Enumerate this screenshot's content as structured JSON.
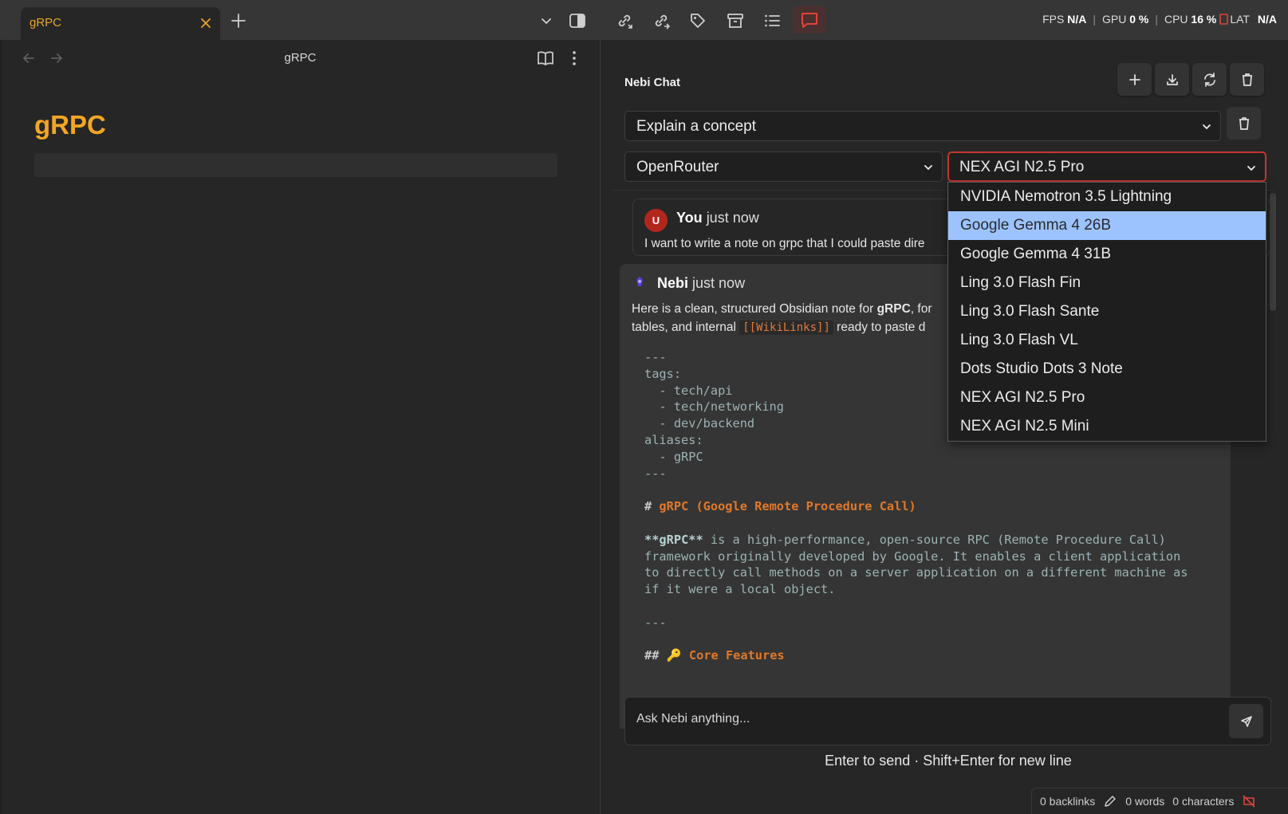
{
  "titlebar": {
    "tab_title": "gRPC",
    "status": {
      "fps_label": "FPS",
      "fps_value": "N/A",
      "gpu_label": "GPU",
      "gpu_value": "0 %",
      "cpu_label": "CPU",
      "cpu_value": "16 %",
      "lat_label": "LAT",
      "lat_value": "N/A",
      "separator": "|"
    }
  },
  "note": {
    "view_title": "gRPC",
    "heading": "gRPC"
  },
  "chat": {
    "title": "Nebi Chat",
    "prompt_select": "Explain a concept",
    "provider_select": "OpenRouter",
    "model_select": "NEX AGI N2.5 Pro",
    "model_options": [
      "NVIDIA Nemotron 3.5 Lightning",
      "Google Gemma 4 26B",
      "Google Gemma 4 31B",
      "Ling 3.0 Flash Fin",
      "Ling 3.0 Flash Sante",
      "Ling 3.0 Flash VL",
      "Dots Studio Dots 3 Note",
      "NEX AGI N2.5 Pro",
      "NEX AGI N2.5 Mini"
    ],
    "highlighted_option": "Google Gemma 4 26B",
    "user_message": {
      "avatar_letter": "U",
      "author": "You",
      "time": "just now",
      "text": "I want to write a note on grpc that I could paste dire"
    },
    "bot_message": {
      "author": "Nebi",
      "time": "just now",
      "intro_1": "Here is a clean, structured Obsidian note for ",
      "intro_bold": "gRPC",
      "intro_2": ", for",
      "intro_3": "tables, and internal ",
      "wikilink": "[[WikiLinks]]",
      "intro_4": " ready to paste d",
      "code": {
        "fm_open": "---",
        "tags_key": "tags:",
        "tag_1": "  - tech/api",
        "tag_2": "  - tech/networking",
        "tag_3": "  - dev/backend",
        "aliases_key": "aliases:",
        "alias_1": "  - gRPC",
        "fm_close": "---",
        "h1_mark": "# ",
        "h1_text": "gRPC (Google Remote Procedure Call)",
        "p_bold": "**gRPC**",
        "p_line1": " is a high-performance, open-source RPC (Remote Procedure Call)",
        "p_line2": "framework originally developed by Google. It enables a client application",
        "p_line3": "to directly call methods on a server application on a different machine as",
        "p_line4": "if it were a local object.",
        "hr": "---",
        "h2_mark": "## ",
        "h2_emoji": "🔑",
        "h2_text": "Core Features"
      }
    },
    "input_placeholder": "Ask Nebi anything...",
    "input_value": "",
    "hint": "Enter to send · Shift+Enter for new line"
  },
  "statusbar": {
    "backlinks": "0 backlinks",
    "words": "0 words",
    "characters": "0 characters"
  },
  "colors": {
    "accent_orange": "#f4a623",
    "active_red": "#c4372f",
    "highlight_blue": "#9dc3ff"
  }
}
